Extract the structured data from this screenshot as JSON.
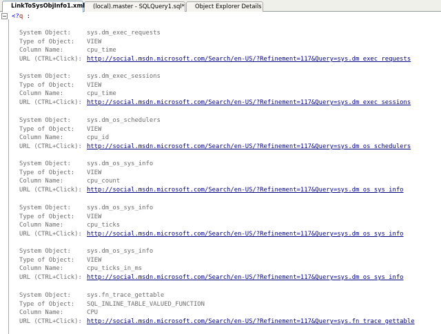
{
  "tabs": [
    {
      "label": "LinkToSysObjInfo1.xml",
      "active": true
    },
    {
      "label": "(local).master - SQLQuery1.sql*",
      "active": false
    },
    {
      "label": "Object Explorer Details",
      "active": false
    }
  ],
  "editor": {
    "collapse_glyph": "−",
    "pi_open": "<?",
    "pi_target": "q",
    "pi_rest": " :"
  },
  "labels": {
    "system_object": "System Object:",
    "type_of_object": "Type of Object:",
    "column_name": "Column Name:",
    "url": "URL (CTRL+Click):"
  },
  "entries": [
    {
      "system_object": "sys.dm_exec_requests",
      "type": "VIEW",
      "column": "cpu_time",
      "url": "http://social.msdn.microsoft.com/Search/en-US/?Refinement=117&Query=sys.dm_exec_requests"
    },
    {
      "system_object": "sys.dm_exec_sessions",
      "type": "VIEW",
      "column": "cpu_time",
      "url": "http://social.msdn.microsoft.com/Search/en-US/?Refinement=117&Query=sys.dm_exec_sessions"
    },
    {
      "system_object": "sys.dm_os_schedulers",
      "type": "VIEW",
      "column": "cpu_id",
      "url": "http://social.msdn.microsoft.com/Search/en-US/?Refinement=117&Query=sys.dm_os_schedulers"
    },
    {
      "system_object": "sys.dm_os_sys_info",
      "type": "VIEW",
      "column": "cpu_count",
      "url": "http://social.msdn.microsoft.com/Search/en-US/?Refinement=117&Query=sys.dm_os_sys_info"
    },
    {
      "system_object": "sys.dm_os_sys_info",
      "type": "VIEW",
      "column": "cpu_ticks",
      "url": "http://social.msdn.microsoft.com/Search/en-US/?Refinement=117&Query=sys.dm_os_sys_info"
    },
    {
      "system_object": "sys.dm_os_sys_info",
      "type": "VIEW",
      "column": "cpu_ticks_in_ms",
      "url": "http://social.msdn.microsoft.com/Search/en-US/?Refinement=117&Query=sys.dm_os_sys_info"
    },
    {
      "system_object": "sys.fn_trace_gettable",
      "type": "SQL_INLINE_TABLE_VALUED_FUNCTION",
      "column": "CPU",
      "url": "http://social.msdn.microsoft.com/Search/en-US/?Refinement=117&Query=sys.fn_trace_gettable"
    }
  ]
}
